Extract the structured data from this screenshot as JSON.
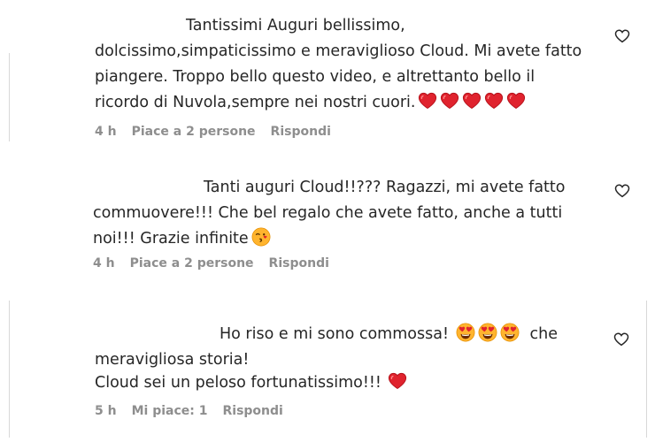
{
  "comments": [
    {
      "lines": [
        "Tantissimi Auguri bellissimo,",
        "dolcissimo,simpaticissimo e meraviglioso Cloud. Mi avete fatto",
        "piangere. Troppo bello questo video, e altrettanto bello il",
        "ricordo di Nuvola,sempre nei nostri cuori."
      ],
      "time": "4 h",
      "likes": "Piace a 2 persone",
      "reply": "Rispondi"
    },
    {
      "lines": [
        "Tanti auguri Cloud!!??? Ragazzi, mi avete fatto",
        "commuovere!!! Che bel regalo che avete fatto, anche a tutti",
        "noi!!! Grazie infinite"
      ],
      "time": "4 h",
      "likes": "Piace a 2 persone",
      "reply": "Rispondi"
    },
    {
      "lines": [
        "Ho riso e mi sono commossa!",
        "che",
        "meravigliosa storia!",
        "Cloud sei un peloso fortunatissimo!!!"
      ],
      "time": "5 h",
      "likes": "Mi piace: 1",
      "reply": "Rispondi"
    }
  ],
  "icons": {
    "like": "heart-outline-icon",
    "emoji_heart": "red-heart-icon",
    "emoji_kiss": "kissing-face-icon",
    "emoji_heart_eyes": "heart-eyes-face-icon"
  },
  "colors": {
    "text": "#262626",
    "meta": "#8e8e8e",
    "heart_red": "#e0232e",
    "emoji_yellow": "#ffb42e"
  }
}
